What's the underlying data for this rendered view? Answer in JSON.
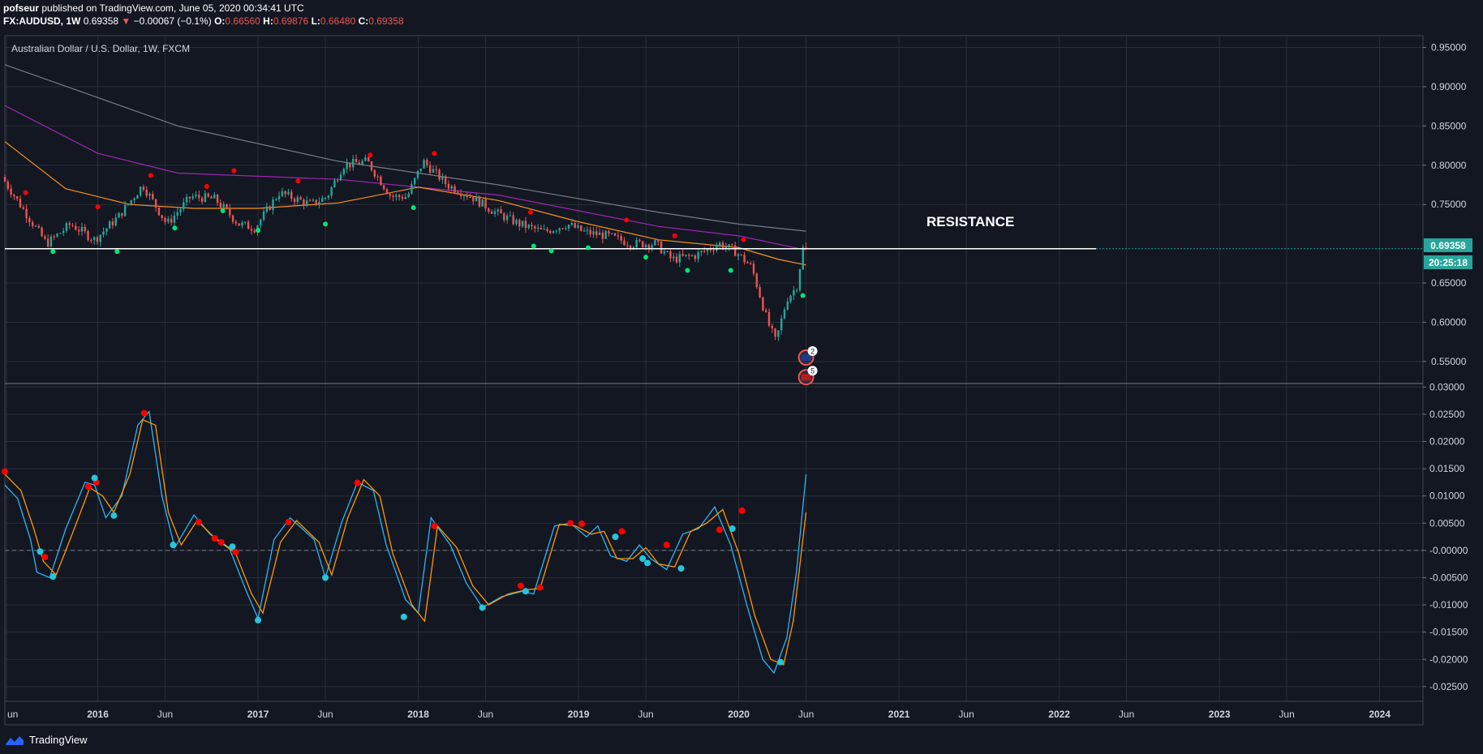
{
  "header": {
    "publisher": "pofseur",
    "published_text": "published on TradingView.com, June 05, 2020 00:34:41 UTC",
    "symbol": "FX:AUDUSD, 1W",
    "last": "0.69358",
    "change_arrow": "▼",
    "change": "−0.00067 (−0.1%)",
    "o_label": "O:",
    "o_value": "0.66560",
    "h_label": "H:",
    "h_value": "0.69876",
    "l_label": "L:",
    "l_value": "0.66480",
    "c_label": "C:",
    "c_value": "0.69358"
  },
  "pane_title": "Australian Dollar / U.S. Dollar, 1W, FXCM",
  "annotation": "RESISTANCE",
  "price_badge": "0.69358",
  "countdown_badge": "20:25:18",
  "event_badges": [
    "2",
    "5"
  ],
  "footer_brand": "TradingView",
  "colors": {
    "background": "#131722",
    "grid": "#2a2e39",
    "up": "#26a69a",
    "down": "#ef5350",
    "ma_orange": "#f7931a",
    "ma_purple": "#9c27b0",
    "ma_gray": "#787b86",
    "osc_fast": "#29b6f6",
    "osc_slow": "#ff9800",
    "marker_red": "#ff0000",
    "marker_green": "#00e676",
    "marker_cyan": "#26c6da",
    "resistance": "#ffffff",
    "badge": "#26a69a"
  },
  "chart_data": [
    {
      "type": "candlestick",
      "title": "Australian Dollar / U.S. Dollar, 1W, FXCM",
      "x_ticks": [
        "un",
        "2016",
        "Jun",
        "2017",
        "Jun",
        "2018",
        "Jun",
        "2019",
        "Jun",
        "2020",
        "Jun",
        "2021",
        "Jun",
        "2022",
        "Jun",
        "2023",
        "Jun",
        "2024"
      ],
      "y_ticks": [
        "0.95000",
        "0.90000",
        "0.85000",
        "0.80000",
        "0.75000",
        "0.65000",
        "0.60000",
        "0.55000"
      ],
      "ylim": [
        0.523,
        0.965
      ],
      "xlim": [
        2015.42,
        2024.27
      ],
      "resistance_level": 0.6936,
      "last_price": 0.69358,
      "price_path": [
        [
          2015.42,
          0.785
        ],
        [
          2015.55,
          0.745
        ],
        [
          2015.7,
          0.7
        ],
        [
          2015.85,
          0.725
        ],
        [
          2016.0,
          0.705
        ],
        [
          2016.15,
          0.735
        ],
        [
          2016.3,
          0.775
        ],
        [
          2016.45,
          0.725
        ],
        [
          2016.6,
          0.76
        ],
        [
          2016.75,
          0.757
        ],
        [
          2016.9,
          0.725
        ],
        [
          2017.0,
          0.72
        ],
        [
          2017.15,
          0.765
        ],
        [
          2017.35,
          0.75
        ],
        [
          2017.45,
          0.76
        ],
        [
          2017.55,
          0.8
        ],
        [
          2017.7,
          0.805
        ],
        [
          2017.85,
          0.76
        ],
        [
          2017.95,
          0.76
        ],
        [
          2018.05,
          0.805
        ],
        [
          2018.2,
          0.775
        ],
        [
          2018.35,
          0.76
        ],
        [
          2018.5,
          0.74
        ],
        [
          2018.65,
          0.725
        ],
        [
          2018.8,
          0.715
        ],
        [
          2018.95,
          0.725
        ],
        [
          2019.05,
          0.715
        ],
        [
          2019.2,
          0.71
        ],
        [
          2019.35,
          0.7
        ],
        [
          2019.5,
          0.7
        ],
        [
          2019.6,
          0.68
        ],
        [
          2019.75,
          0.685
        ],
        [
          2019.9,
          0.7
        ],
        [
          2020.0,
          0.69
        ],
        [
          2020.1,
          0.67
        ],
        [
          2020.2,
          0.6
        ],
        [
          2020.25,
          0.575
        ],
        [
          2020.32,
          0.63
        ],
        [
          2020.38,
          0.645
        ],
        [
          2020.42,
          0.694
        ]
      ],
      "series": [
        {
          "name": "",
          "color": "#787b86",
          "points": [
            [
              2015.42,
              0.928
            ],
            [
              2016.5,
              0.85
            ],
            [
              2017.5,
              0.805
            ],
            [
              2018.5,
              0.775
            ],
            [
              2019.5,
              0.74
            ],
            [
              2020.0,
              0.725
            ],
            [
              2020.42,
              0.716
            ]
          ]
        },
        {
          "name": "",
          "color": "#9c27b0",
          "points": [
            [
              2015.42,
              0.876
            ],
            [
              2016.0,
              0.815
            ],
            [
              2016.5,
              0.79
            ],
            [
              2017.5,
              0.782
            ],
            [
              2018.5,
              0.762
            ],
            [
              2019.5,
              0.722
            ],
            [
              2020.0,
              0.71
            ],
            [
              2020.42,
              0.692
            ]
          ]
        },
        {
          "name": "",
          "color": "#f7931a",
          "points": [
            [
              2015.42,
              0.83
            ],
            [
              2015.8,
              0.77
            ],
            [
              2016.2,
              0.75
            ],
            [
              2016.6,
              0.745
            ],
            [
              2017.0,
              0.745
            ],
            [
              2017.5,
              0.752
            ],
            [
              2018.0,
              0.772
            ],
            [
              2018.5,
              0.755
            ],
            [
              2019.0,
              0.728
            ],
            [
              2019.5,
              0.705
            ],
            [
              2020.0,
              0.695
            ],
            [
              2020.25,
              0.68
            ],
            [
              2020.42,
              0.673
            ]
          ]
        }
      ],
      "pivot_highs": [
        [
          2015.55,
          0.765
        ],
        [
          2016.0,
          0.747
        ],
        [
          2016.33,
          0.787
        ],
        [
          2016.68,
          0.773
        ],
        [
          2016.85,
          0.793
        ],
        [
          2017.25,
          0.78
        ],
        [
          2017.7,
          0.813
        ],
        [
          2018.1,
          0.815
        ],
        [
          2018.7,
          0.74
        ],
        [
          2019.3,
          0.73
        ],
        [
          2019.6,
          0.71
        ],
        [
          2020.03,
          0.705
        ]
      ],
      "pivot_lows": [
        [
          2015.72,
          0.69
        ],
        [
          2016.12,
          0.69
        ],
        [
          2016.48,
          0.72
        ],
        [
          2016.78,
          0.742
        ],
        [
          2017.0,
          0.717
        ],
        [
          2017.42,
          0.725
        ],
        [
          2017.97,
          0.746
        ],
        [
          2018.72,
          0.697
        ],
        [
          2018.83,
          0.691
        ],
        [
          2019.06,
          0.695
        ],
        [
          2019.42,
          0.683
        ],
        [
          2019.68,
          0.666
        ],
        [
          2019.95,
          0.666
        ],
        [
          2020.4,
          0.634
        ]
      ],
      "event_markers": [
        [
          2020.42,
          0.555
        ],
        [
          2020.42,
          0.53
        ]
      ]
    },
    {
      "type": "line",
      "x_ticks": [
        "un",
        "2016",
        "Jun",
        "2017",
        "Jun",
        "2018",
        "Jun",
        "2019",
        "Jun",
        "2020",
        "Jun",
        "2021",
        "Jun",
        "2022",
        "Jun",
        "2023",
        "Jun",
        "2024"
      ],
      "y_ticks": [
        "0.03000",
        "0.02500",
        "0.02000",
        "0.01500",
        "0.01000",
        "0.00500",
        "-0.00000",
        "-0.00500",
        "-0.01000",
        "-0.01500",
        "-0.02000",
        "-0.02500"
      ],
      "ylim": [
        -0.0277,
        0.0305
      ],
      "xlim": [
        2015.42,
        2024.27
      ],
      "zero_line": 0,
      "series": [
        {
          "name": "",
          "color": "#29b6f6",
          "points": [
            [
              2015.42,
              0.012
            ],
            [
              2015.5,
              0.0095
            ],
            [
              2015.58,
              0.002
            ],
            [
              2015.62,
              -0.004
            ],
            [
              2015.7,
              -0.005
            ],
            [
              2015.8,
              0.004
            ],
            [
              2015.92,
              0.0125
            ],
            [
              2015.98,
              0.012
            ],
            [
              2016.05,
              0.006
            ],
            [
              2016.15,
              0.01
            ],
            [
              2016.25,
              0.023
            ],
            [
              2016.32,
              0.0255
            ],
            [
              2016.4,
              0.01
            ],
            [
              2016.48,
              0.0005
            ],
            [
              2016.6,
              0.0065
            ],
            [
              2016.7,
              0.003
            ],
            [
              2016.82,
              0.0005
            ],
            [
              2016.92,
              -0.007
            ],
            [
              2017.0,
              -0.0125
            ],
            [
              2017.1,
              0.002
            ],
            [
              2017.2,
              0.006
            ],
            [
              2017.35,
              0.002
            ],
            [
              2017.42,
              -0.005
            ],
            [
              2017.52,
              0.005
            ],
            [
              2017.62,
              0.0125
            ],
            [
              2017.72,
              0.011
            ],
            [
              2017.8,
              0.001
            ],
            [
              2017.92,
              -0.009
            ],
            [
              2018.0,
              -0.0115
            ],
            [
              2018.08,
              0.006
            ],
            [
              2018.2,
              0.001
            ],
            [
              2018.3,
              -0.006
            ],
            [
              2018.4,
              -0.0105
            ],
            [
              2018.52,
              -0.0085
            ],
            [
              2018.65,
              -0.0075
            ],
            [
              2018.72,
              -0.008
            ],
            [
              2018.85,
              0.0045
            ],
            [
              2018.95,
              0.005
            ],
            [
              2019.05,
              0.0025
            ],
            [
              2019.12,
              0.0045
            ],
            [
              2019.2,
              -0.001
            ],
            [
              2019.3,
              -0.002
            ],
            [
              2019.38,
              0.001
            ],
            [
              2019.45,
              -0.0015
            ],
            [
              2019.55,
              -0.0035
            ],
            [
              2019.65,
              0.003
            ],
            [
              2019.75,
              0.004
            ],
            [
              2019.85,
              0.008
            ],
            [
              2019.95,
              0.001
            ],
            [
              2020.05,
              -0.01
            ],
            [
              2020.15,
              -0.02
            ],
            [
              2020.22,
              -0.0225
            ],
            [
              2020.3,
              -0.016
            ],
            [
              2020.36,
              -0.004
            ],
            [
              2020.42,
              0.014
            ]
          ]
        },
        {
          "name": "",
          "color": "#ff9800",
          "points": [
            [
              2015.42,
              0.014
            ],
            [
              2015.52,
              0.011
            ],
            [
              2015.6,
              0.004
            ],
            [
              2015.66,
              -0.002
            ],
            [
              2015.74,
              -0.0045
            ],
            [
              2015.84,
              0.003
            ],
            [
              2015.95,
              0.0115
            ],
            [
              2016.03,
              0.01
            ],
            [
              2016.1,
              0.007
            ],
            [
              2016.2,
              0.014
            ],
            [
              2016.28,
              0.024
            ],
            [
              2016.36,
              0.023
            ],
            [
              2016.44,
              0.007
            ],
            [
              2016.52,
              0.001
            ],
            [
              2016.62,
              0.0055
            ],
            [
              2016.74,
              0.002
            ],
            [
              2016.86,
              -0.0005
            ],
            [
              2016.96,
              -0.008
            ],
            [
              2017.03,
              -0.0115
            ],
            [
              2017.14,
              0.0015
            ],
            [
              2017.24,
              0.0055
            ],
            [
              2017.38,
              0.0015
            ],
            [
              2017.46,
              -0.0045
            ],
            [
              2017.56,
              0.006
            ],
            [
              2017.66,
              0.013
            ],
            [
              2017.76,
              0.01
            ],
            [
              2017.84,
              -0.0005
            ],
            [
              2017.96,
              -0.01
            ],
            [
              2018.04,
              -0.013
            ],
            [
              2018.12,
              0.0045
            ],
            [
              2018.24,
              0.0005
            ],
            [
              2018.34,
              -0.0065
            ],
            [
              2018.44,
              -0.01
            ],
            [
              2018.56,
              -0.008
            ],
            [
              2018.68,
              -0.0072
            ],
            [
              2018.76,
              -0.007
            ],
            [
              2018.88,
              0.0048
            ],
            [
              2018.98,
              0.0045
            ],
            [
              2019.08,
              0.003
            ],
            [
              2019.16,
              0.0035
            ],
            [
              2019.24,
              -0.0015
            ],
            [
              2019.34,
              -0.0015
            ],
            [
              2019.42,
              0.0005
            ],
            [
              2019.5,
              -0.0025
            ],
            [
              2019.6,
              -0.003
            ],
            [
              2019.7,
              0.0035
            ],
            [
              2019.8,
              0.005
            ],
            [
              2019.9,
              0.0075
            ],
            [
              2020.0,
              -0.0005
            ],
            [
              2020.1,
              -0.012
            ],
            [
              2020.2,
              -0.02
            ],
            [
              2020.28,
              -0.021
            ],
            [
              2020.34,
              -0.013
            ],
            [
              2020.42,
              0.007
            ]
          ]
        }
      ],
      "markers_red": [
        [
          2015.42,
          0.0145
        ],
        [
          2015.67,
          -0.0012
        ],
        [
          2015.94,
          0.0117
        ],
        [
          2015.99,
          0.0125
        ],
        [
          2016.29,
          0.0252
        ],
        [
          2016.63,
          0.0052
        ],
        [
          2016.73,
          0.0022
        ],
        [
          2016.77,
          0.0015
        ],
        [
          2016.86,
          -0.0003
        ],
        [
          2017.19,
          0.0052
        ],
        [
          2017.62,
          0.0124
        ],
        [
          2018.1,
          0.0045
        ],
        [
          2018.64,
          -0.0065
        ],
        [
          2018.76,
          -0.0068
        ],
        [
          2018.95,
          0.005
        ],
        [
          2019.02,
          0.0049
        ],
        [
          2019.27,
          0.0035
        ],
        [
          2019.55,
          0.001
        ],
        [
          2019.88,
          0.0038
        ],
        [
          2020.02,
          0.0073
        ]
      ],
      "markers_cyan": [
        [
          2015.64,
          -0.0002
        ],
        [
          2015.72,
          -0.0048
        ],
        [
          2015.98,
          0.0133
        ],
        [
          2016.1,
          0.0064
        ],
        [
          2016.47,
          0.001
        ],
        [
          2016.84,
          0.0007
        ],
        [
          2017.0,
          -0.0128
        ],
        [
          2017.42,
          -0.005
        ],
        [
          2017.91,
          -0.0122
        ],
        [
          2018.4,
          -0.0105
        ],
        [
          2018.67,
          -0.0075
        ],
        [
          2019.23,
          0.0025
        ],
        [
          2019.4,
          -0.0015
        ],
        [
          2019.43,
          -0.0023
        ],
        [
          2019.64,
          -0.0033
        ],
        [
          2019.96,
          0.004
        ],
        [
          2020.26,
          -0.0205
        ]
      ]
    }
  ]
}
